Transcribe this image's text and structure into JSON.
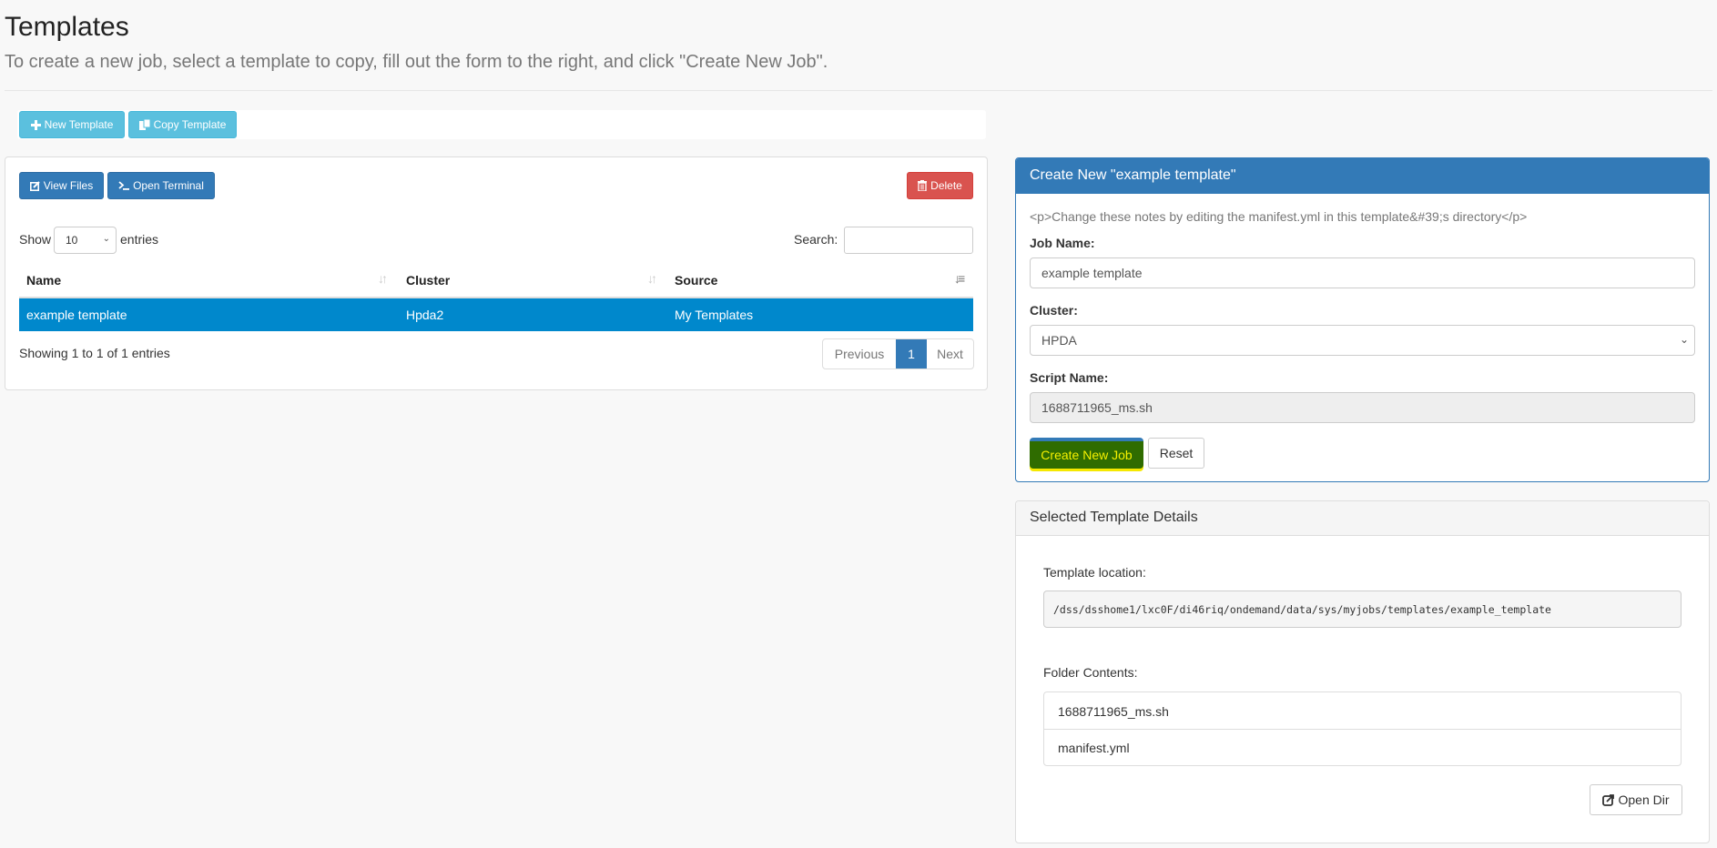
{
  "header": {
    "title": "Templates",
    "subtitle": "To create a new job, select a template to copy, fill out the form to the right, and click \"Create New Job\"."
  },
  "toolbar": {
    "new_template": {
      "label": "New Template",
      "icon": "plus-icon"
    },
    "copy_template": {
      "label": "Copy Template",
      "icon": "copy-icon"
    }
  },
  "templates_panel": {
    "view_files": {
      "label": "View Files",
      "icon": "edit-icon"
    },
    "open_terminal": {
      "label": "Open Terminal",
      "icon": "terminal-icon"
    },
    "delete": {
      "label": "Delete",
      "icon": "trash-icon"
    },
    "length": {
      "show_label": "Show",
      "value": "10",
      "entries_label": "entries"
    },
    "search": {
      "label": "Search:",
      "value": ""
    },
    "table": {
      "columns": [
        "Name",
        "Cluster",
        "Source"
      ],
      "rows": [
        {
          "name": "example template",
          "cluster": "Hpda2",
          "source": "My Templates",
          "selected": true
        }
      ]
    },
    "info": "Showing 1 to 1 of 1 entries",
    "pagination": {
      "previous": "Previous",
      "current": "1",
      "next": "Next"
    }
  },
  "create_panel": {
    "title": "Create New \"example template\"",
    "notes": "<p>Change these notes by editing the manifest.yml in this template&#39;s directory</p>",
    "job_name": {
      "label": "Job Name:",
      "value": "example template"
    },
    "cluster": {
      "label": "Cluster:",
      "value": "HPDA"
    },
    "script_name": {
      "label": "Script Name:",
      "value": "1688711965_ms.sh"
    },
    "create_button": "Create New Job",
    "reset_button": "Reset"
  },
  "details_panel": {
    "title": "Selected Template Details",
    "location_label": "Template location:",
    "location": "/dss/dsshome1/lxc0F/di46riq/ondemand/data/sys/myjobs/templates/example_template",
    "folder_label": "Folder Contents:",
    "files": [
      "1688711965_ms.sh",
      "manifest.yml"
    ],
    "open_dir": {
      "label": "Open Dir",
      "icon": "external-link-icon"
    }
  },
  "colors": {
    "primary": "#337ab7",
    "info": "#5bc0de",
    "danger": "#d9534f",
    "selected_row": "#0088cc",
    "create_button_bg": "#2f6c00",
    "create_button_text": "#f5f000"
  }
}
